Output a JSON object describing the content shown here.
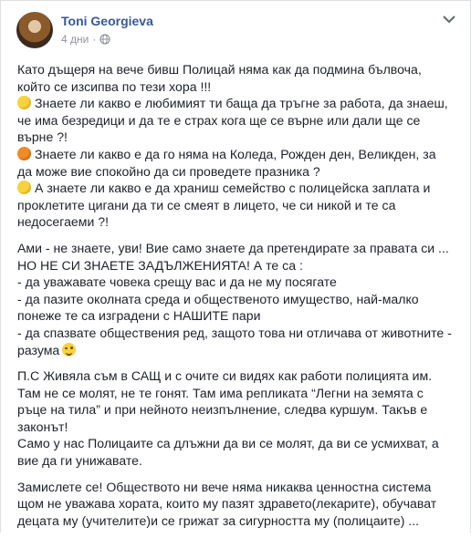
{
  "post": {
    "author": "Toni Georgieva",
    "time": "4 дни",
    "separator": "·",
    "icons": {
      "privacy": "globe-icon",
      "menu": "chevron-down-icon"
    },
    "paragraphs": [
      {
        "lines": [
          {
            "text": "Като дъщеря на вече бивш Полицай няма как да подмина бълвоча,"
          },
          {
            "text": "който се изсипва по тези хора !!!"
          },
          {
            "emoji": "yellow",
            "text": "Знаете ли какво е любимият ти баща да тръгне за работа, да знаеш,"
          },
          {
            "text": "че има безредици и да те е страх кога ще се върне или дали ще се"
          },
          {
            "text": "върне ?!"
          },
          {
            "emoji": "orange",
            "text": "Знаете ли какво е да го няма на Коледа, Рожден ден, Великден, за"
          },
          {
            "text": "да може вие спокойно да си проведете празника ?"
          },
          {
            "emoji": "yellow",
            "text": "А знаете ли какво е да храниш семейство с полицейска заплата и"
          },
          {
            "text": "проклетите цигани да ти се смеят в лицето, че си никой и те са"
          },
          {
            "text": "недосегаеми ?!"
          }
        ]
      },
      {
        "lines": [
          {
            "text": "Ами - не знаете, уви! Вие само знаете да претендирате за правата си ..."
          },
          {
            "text": "НО НЕ СИ ЗНАЕТЕ ЗАДЪЛЖЕНИЯТА! А те са :"
          },
          {
            "text": "- да уважавате човека срещу вас и да не му посягате"
          },
          {
            "text": "- да пазите околната среда и общественото имущество, най-малко"
          },
          {
            "text": "понеже те са изградени с НАШИТЕ пари"
          },
          {
            "text": "- да спазвате обществения ред, защото това ни отличава от животните -"
          },
          {
            "text": "разума",
            "wink": true
          }
        ]
      },
      {
        "lines": [
          {
            "text": "П.С Живяла съм в САЩ и с очите си видях как работи полицията им."
          },
          {
            "text": "Там не се молят, не те гонят. Там има репликата “Легни на земята с"
          },
          {
            "text": "ръце на тила” и при нейното неизпълнение, следва куршум. Такъв е"
          },
          {
            "text": "законът!"
          },
          {
            "text": "Само у нас Полицаите са длъжни да ви се молят, да ви се усмихват, а"
          },
          {
            "text": "вие да ги унижавате."
          }
        ]
      },
      {
        "lines": [
          {
            "text": "Замислете се! Обществото ни вече няма никаква ценностна система"
          },
          {
            "text": "щом не уважава хората, които му пазят здравето(лекарите), обучават"
          },
          {
            "text": "децата му (учителите)и се грижат за сигурността му (полицаите) ..."
          }
        ]
      }
    ]
  },
  "colors": {
    "author": "#385898",
    "text": "#1d2129",
    "meta": "#90949c",
    "emoji_yellow": "#f7d13f",
    "emoji_orange": "#f08a24"
  }
}
